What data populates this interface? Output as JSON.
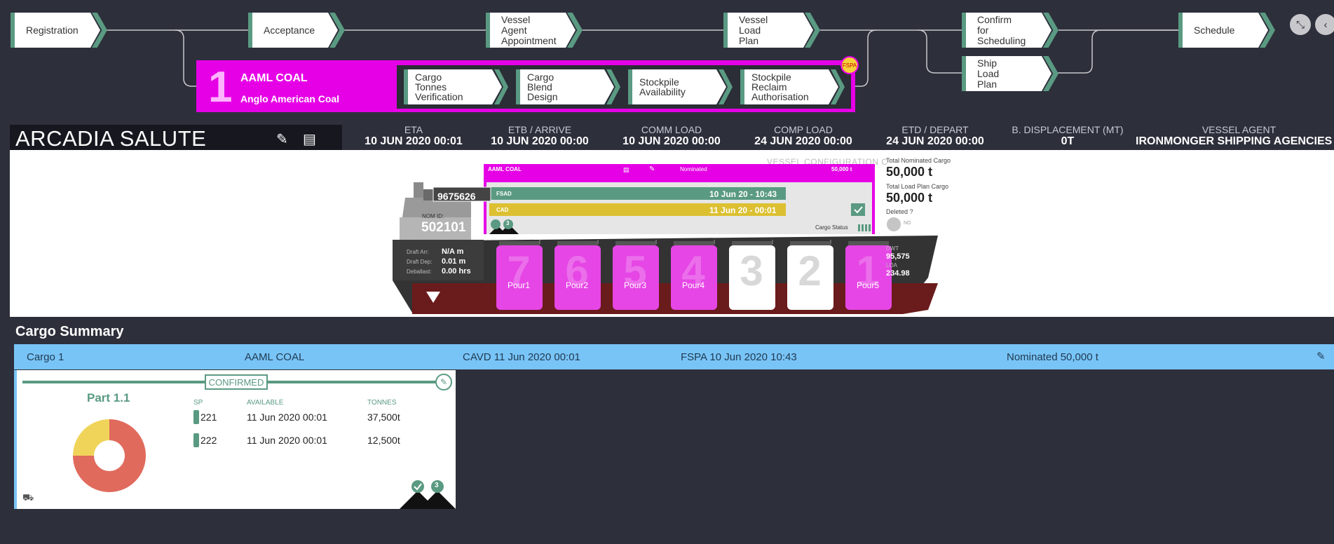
{
  "workflow": {
    "steps": [
      {
        "label": "Registration"
      },
      {
        "label": "Acceptance"
      },
      {
        "label": "Vessel\nAgent\nAppointment"
      },
      {
        "label": "Vessel\nLoad\nPlan"
      },
      {
        "label": "Confirm\nfor\nScheduling"
      },
      {
        "label": "Ship\nLoad\nPlan"
      },
      {
        "label": "Schedule"
      }
    ],
    "cargo": {
      "number": "1",
      "name": "AAML COAL",
      "owner": "Anglo American Coal",
      "badge": "FSPA",
      "substeps": [
        {
          "label": "Cargo\nTonnes\nVerification"
        },
        {
          "label": "Cargo\nBlend\nDesign"
        },
        {
          "label": "Stockpile\nAvailability"
        },
        {
          "label": "Stockpile\nReclaim\nAuthorisation"
        }
      ]
    },
    "right_buttons": {
      "collapse_icon": "compress-arrows-icon",
      "back_icon": "chevron-left-icon"
    }
  },
  "vessel": {
    "name": "ARCADIA SALUTE",
    "fields": [
      {
        "label": "ETA",
        "value": "10 JUN 2020 00:01"
      },
      {
        "label": "ETB / ARRIVE",
        "value": "10 JUN 2020 00:00"
      },
      {
        "label": "COMM LOAD",
        "value": "10 JUN 2020 00:00"
      },
      {
        "label": "COMP LOAD",
        "value": "24 JUN 2020 00:00"
      },
      {
        "label": "ETD / DEPART",
        "value": "24 JUN 2020 00:00"
      },
      {
        "label": "B. DISPLACEMENT (MT)",
        "value": "0T"
      },
      {
        "label": "VESSEL AGENT",
        "value": "IRONMONGER SHIPPING AGENCIES"
      }
    ],
    "config_label": "VESSEL CONFIGURATION C",
    "imo": "9675626",
    "nom_id_label": "NOM ID:",
    "nom_id": "502101",
    "draft": [
      {
        "label": "Draft Arr:",
        "value": "N/A m"
      },
      {
        "label": "Draft Dep:",
        "value": "0.01 m"
      },
      {
        "label": "Deballast:",
        "value": "0.00 hrs"
      }
    ],
    "cargo_card": {
      "name": "AAML COAL",
      "status": "Nominated",
      "tonnes": "50,000 t",
      "fsad_label": "FSAD",
      "fsad_value": "10 Jun 20 - 10:43",
      "cad_label": "CAD",
      "cad_value": "11 Jun 20 - 00:01",
      "cargo_status_label": "Cargo Status",
      "check_count": "3"
    },
    "holds": [
      {
        "num": "7",
        "label": "Pour1",
        "filled": true
      },
      {
        "num": "6",
        "label": "Pour2",
        "filled": true
      },
      {
        "num": "5",
        "label": "Pour3",
        "filled": true
      },
      {
        "num": "4",
        "label": "Pour4",
        "filled": true
      },
      {
        "num": "3",
        "label": "",
        "filled": false
      },
      {
        "num": "2",
        "label": "",
        "filled": false
      },
      {
        "num": "1",
        "label": "Pour5",
        "filled": true
      }
    ],
    "dwt_label": "DWT",
    "dwt": "95,575",
    "loa_label": "LOA",
    "loa": "234.98",
    "totals": {
      "nominated_label": "Total Nominated Cargo",
      "nominated": "50,000 t",
      "load_plan_label": "Total Load Plan Cargo",
      "load_plan": "50,000 t",
      "deleted_label": "Deleted ?",
      "deleted_value": "NO"
    }
  },
  "summary": {
    "title": "Cargo Summary",
    "bar": {
      "cargo": "Cargo 1",
      "name": "AAML COAL",
      "cavd": "CAVD 11 Jun 2020 00:01",
      "fspa": "FSPA 10 Jun 2020 10:43",
      "nominated": "Nominated 50,000 t"
    },
    "part": {
      "status": "CONFIRMED",
      "title": "Part 1.1",
      "headers": {
        "sp": "SP",
        "available": "AVAILABLE",
        "tonnes": "TONNES"
      },
      "rows": [
        {
          "sp": "221",
          "available": "11 Jun 2020 00:01",
          "tonnes": "37,500t"
        },
        {
          "sp": "222",
          "available": "11 Jun 2020 00:01",
          "tonnes": "12,500t"
        }
      ],
      "donut": [
        {
          "value": 37500,
          "color": "#e06a5c"
        },
        {
          "value": 12500,
          "color": "#f0d45a"
        }
      ],
      "check_count": "3"
    }
  },
  "colors": {
    "accent": "#5a9a82",
    "magenta": "#e600e6",
    "blue": "#79c4f7"
  }
}
